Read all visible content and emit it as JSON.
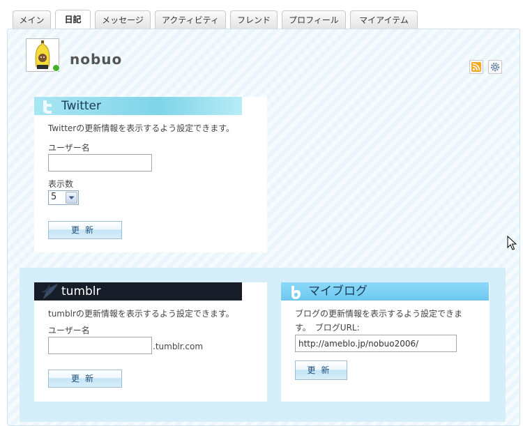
{
  "tabs": [
    {
      "label": "メイン"
    },
    {
      "label": "日記"
    },
    {
      "label": "メッセージ"
    },
    {
      "label": "アクティビティ"
    },
    {
      "label": "フレンド"
    },
    {
      "label": "プロフィール"
    },
    {
      "label": "マイアイテム"
    }
  ],
  "active_tab": "日記",
  "profile": {
    "username": "nobuo"
  },
  "icons": {
    "rss": "rss-icon",
    "settings": "gear-icon"
  },
  "twitter": {
    "title": "Twitter",
    "description": "Twitterの更新情報を表示するよう設定できます。",
    "username_label": "ユーザー名",
    "username_value": "",
    "count_label": "表示数",
    "count_value": "5",
    "button_label": "更新"
  },
  "tumblr": {
    "title": "tumblr",
    "description": "tumblrの更新情報を表示するよう設定できます。",
    "username_label": "ユーザー名",
    "username_value": "",
    "domain_suffix": ".tumblr.com",
    "button_label": "更新"
  },
  "myblog": {
    "title": "マイブログ",
    "description_line1": "ブログの更新情報を表示するよう設定できま",
    "description_line2": "す。　ブログURL:",
    "url_value": "http://ameblo.jp/nobuo2006/",
    "button_label": "更新"
  },
  "colors": {
    "panel_bg": "#eaf6fb",
    "twitter_header": "#7fd4e8",
    "tumblr_header": "#1a2230",
    "myblog_header": "#7cd0f5",
    "button_text": "#1e4e79"
  }
}
